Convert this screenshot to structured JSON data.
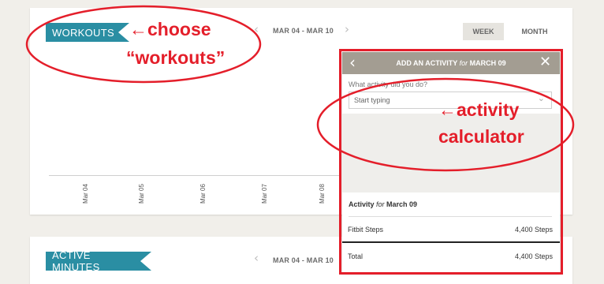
{
  "workouts_card": {
    "ribbon_label": "WORKOUTS",
    "date_range": "MAR 04 - MAR 10",
    "tabs": [
      "WEEK",
      "MONTH"
    ],
    "x_labels": [
      "Mar 04",
      "Mar 05",
      "Mar 06",
      "Mar 07",
      "Mar 08"
    ]
  },
  "active_minutes_card": {
    "ribbon_label": "ACTIVE MINUTES",
    "date_range": "MAR 04 - MAR 10"
  },
  "add_activity_panel": {
    "title_prefix": "ADD AN ACTIVITY ",
    "title_for": "for",
    "title_date": " MARCH 09",
    "question": "What activity did you do?",
    "input_placeholder": "Start typing",
    "summary_title_prefix": "Activity ",
    "summary_title_for": "for",
    "summary_title_date": " March 09",
    "rows": [
      {
        "label": "Fitbit Steps",
        "value": "4,400 Steps"
      }
    ],
    "total_label": "Total",
    "total_value": "4,400 Steps"
  },
  "annotations": {
    "choose_line1": "←choose",
    "choose_line2": "“workouts”",
    "calc_line1": "←activity",
    "calc_line2": "calculator"
  },
  "colors": {
    "ribbon": "#2a8ea3",
    "panel_header": "#a39d92",
    "annotation": "#e41e2a"
  }
}
